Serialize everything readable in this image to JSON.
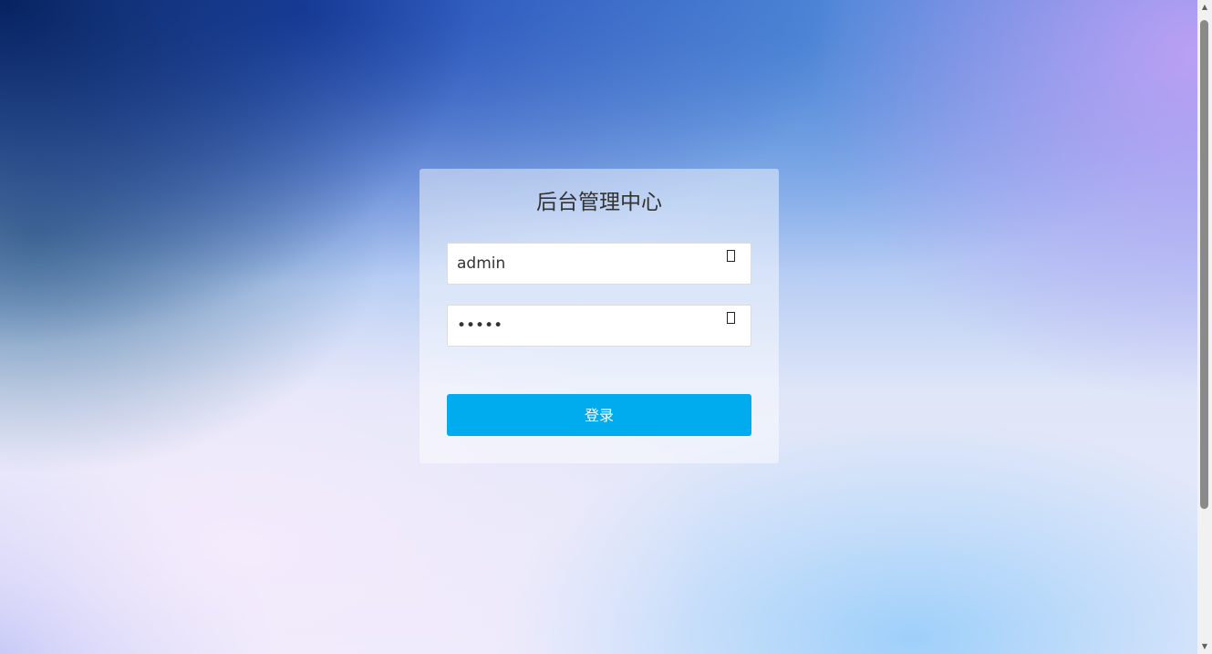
{
  "page": {
    "title": "后台管理中心"
  },
  "login_form": {
    "username_value": "admin",
    "username_icon": "user-icon",
    "password_value": "admin",
    "password_icon": "lock-icon",
    "submit_label": "登录"
  },
  "scrollbar": {
    "up_arrow": "▲",
    "down_arrow": "▼"
  },
  "colors": {
    "button": "#00abee",
    "title_text": "#333333"
  }
}
